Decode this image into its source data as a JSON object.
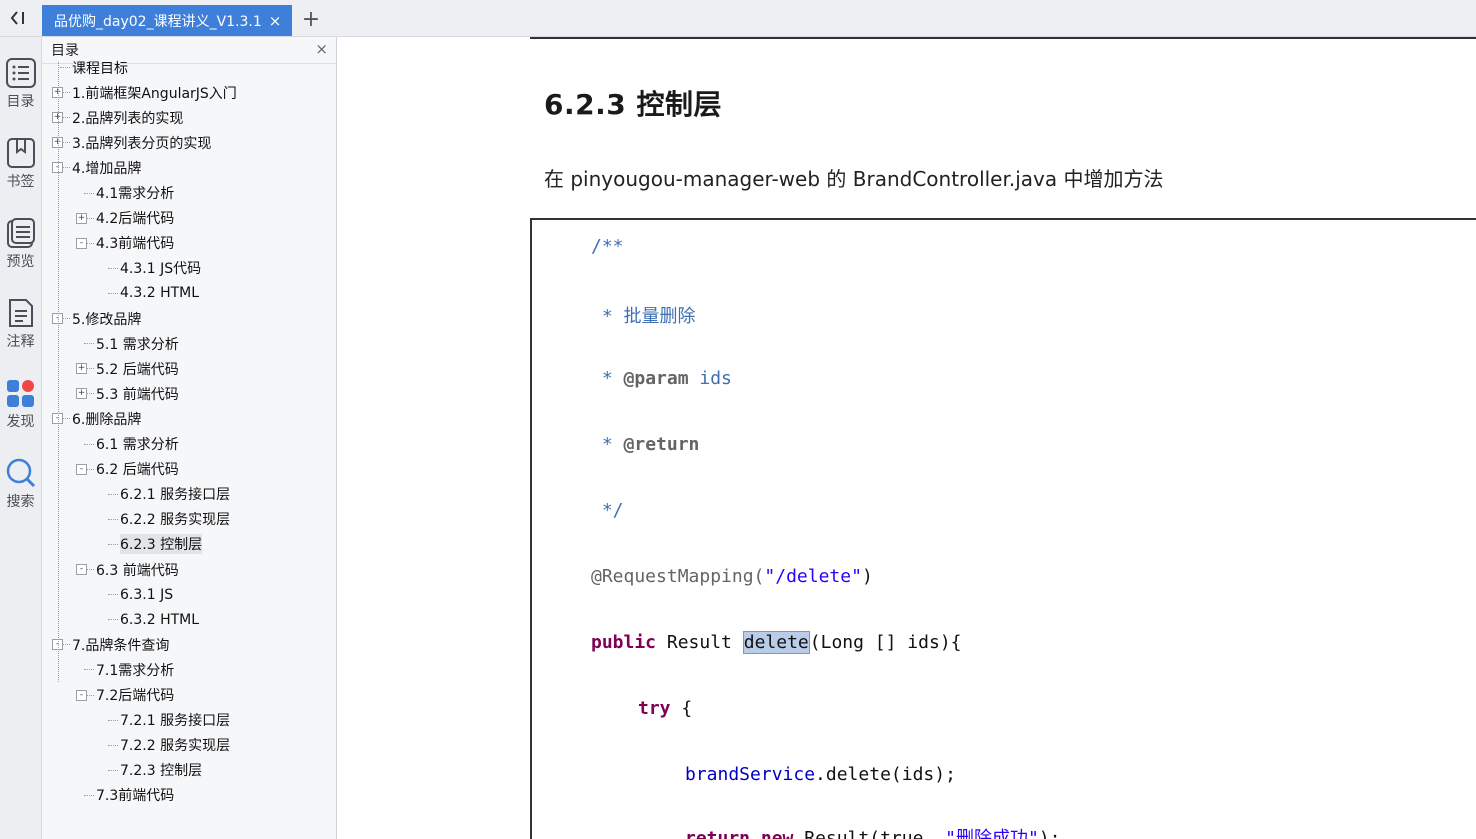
{
  "tabbar": {
    "back_icon": "collapse-left-icon",
    "tab_title": "品优购_day02_课程讲义_V1.3.1",
    "close_glyph": "×",
    "new_tab_glyph": "+"
  },
  "rail": {
    "items": [
      {
        "label": "目录",
        "icon": "toc-list-icon"
      },
      {
        "label": "书签",
        "icon": "bookmark-icon"
      },
      {
        "label": "预览",
        "icon": "preview-icon"
      },
      {
        "label": "注释",
        "icon": "annotation-icon"
      },
      {
        "label": "发现",
        "icon": "discover-icon"
      },
      {
        "label": "搜索",
        "icon": "search-icon"
      }
    ]
  },
  "toc": {
    "title": "目录",
    "close_glyph": "×",
    "items": [
      {
        "label": "课程目标",
        "level": 0,
        "expander": ""
      },
      {
        "label": "1.前端框架AngularJS入门",
        "level": 0,
        "expander": "+"
      },
      {
        "label": "2.品牌列表的实现",
        "level": 0,
        "expander": "+"
      },
      {
        "label": "3.品牌列表分页的实现",
        "level": 0,
        "expander": "+"
      },
      {
        "label": "4.增加品牌",
        "level": 0,
        "expander": "-"
      },
      {
        "label": "4.1需求分析",
        "level": 1,
        "expander": ""
      },
      {
        "label": "4.2后端代码",
        "level": 1,
        "expander": "+"
      },
      {
        "label": "4.3前端代码",
        "level": 1,
        "expander": "-"
      },
      {
        "label": "4.3.1 JS代码",
        "level": 2,
        "expander": ""
      },
      {
        "label": "4.3.2 HTML",
        "level": 2,
        "expander": ""
      },
      {
        "label": "5.修改品牌",
        "level": 0,
        "expander": "-"
      },
      {
        "label": "5.1 需求分析",
        "level": 1,
        "expander": ""
      },
      {
        "label": "5.2 后端代码",
        "level": 1,
        "expander": "+"
      },
      {
        "label": "5.3 前端代码",
        "level": 1,
        "expander": "+"
      },
      {
        "label": "6.删除品牌",
        "level": 0,
        "expander": "-"
      },
      {
        "label": "6.1 需求分析",
        "level": 1,
        "expander": ""
      },
      {
        "label": "6.2 后端代码",
        "level": 1,
        "expander": "-"
      },
      {
        "label": "6.2.1 服务接口层",
        "level": 2,
        "expander": ""
      },
      {
        "label": "6.2.2 服务实现层",
        "level": 2,
        "expander": ""
      },
      {
        "label": "6.2.3 控制层",
        "level": 2,
        "expander": "",
        "selected": true
      },
      {
        "label": "6.3 前端代码",
        "level": 1,
        "expander": "-"
      },
      {
        "label": "6.3.1 JS",
        "level": 2,
        "expander": ""
      },
      {
        "label": "6.3.2 HTML",
        "level": 2,
        "expander": ""
      },
      {
        "label": "7.品牌条件查询",
        "level": 0,
        "expander": "-"
      },
      {
        "label": "7.1需求分析",
        "level": 1,
        "expander": ""
      },
      {
        "label": "7.2后端代码",
        "level": 1,
        "expander": "-"
      },
      {
        "label": "7.2.1 服务接口层",
        "level": 2,
        "expander": ""
      },
      {
        "label": "7.2.2 服务实现层",
        "level": 2,
        "expander": ""
      },
      {
        "label": "7.2.3 控制层",
        "level": 2,
        "expander": ""
      },
      {
        "label": "7.3前端代码",
        "level": 1,
        "expander": ""
      }
    ]
  },
  "document": {
    "heading": "6.2.3 控制层",
    "paragraph": "在 pinyougou-manager-web 的 BrandController.java 中增加方法",
    "code": {
      "l1": "/**",
      "l2": " * 批量删除",
      "l3a": " * ",
      "l3b": "@param",
      "l3c": " ids",
      "l4a": " * ",
      "l4b": "@return",
      "l5": " */",
      "l6a": "@RequestMapping(",
      "l6b": "\"/delete\"",
      "l6c": ")",
      "l7a": "public",
      "l7b": " Result ",
      "l7c": "delete",
      "l7d": "(Long [",
      "l7e": "]",
      "l7f": " ids){",
      "l8a": "try",
      "l8b": " {",
      "l9a": "brandService",
      "l9b": ".delete(ids);",
      "l10a": "return",
      "l10b": " new",
      "l10c": " Result(true, ",
      "l10d": "\"删除成功\"",
      "l10e": ");"
    }
  }
}
